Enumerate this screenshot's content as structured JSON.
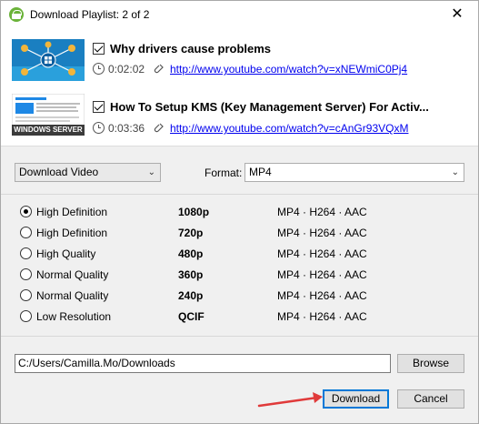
{
  "window": {
    "title": "Download Playlist: 2 of 2",
    "close_glyph": "✕"
  },
  "playlist": [
    {
      "title": "Why drivers cause problems",
      "duration": "0:02:02",
      "url": "http://www.youtube.com/watch?v=xNEWmiC0Pj4",
      "checked": true,
      "thumb_icon": "network-diagram-thumbnail"
    },
    {
      "title": "How To Setup KMS (Key Management Server) For Activ...",
      "duration": "0:03:36",
      "url": "http://www.youtube.com/watch?v=cAnGr93VQxM",
      "checked": true,
      "thumb_icon": "windows-server-thumbnail",
      "thumb_caption": "WINDOWS SERVER"
    }
  ],
  "options": {
    "download_type": "Download Video",
    "format_label": "Format:",
    "format_value": "MP4"
  },
  "qualities": [
    {
      "label": "High Definition",
      "resolution": "1080p",
      "codec": "MP4 · H264 · AAC",
      "selected": true
    },
    {
      "label": "High Definition",
      "resolution": "720p",
      "codec": "MP4 · H264 · AAC",
      "selected": false
    },
    {
      "label": "High Quality",
      "resolution": "480p",
      "codec": "MP4 · H264 · AAC",
      "selected": false
    },
    {
      "label": "Normal Quality",
      "resolution": "360p",
      "codec": "MP4 · H264 · AAC",
      "selected": false
    },
    {
      "label": "Normal Quality",
      "resolution": "240p",
      "codec": "MP4 · H264 · AAC",
      "selected": false
    },
    {
      "label": "Low Resolution",
      "resolution": "QCIF",
      "codec": "MP4 · H264 · AAC",
      "selected": false
    }
  ],
  "save": {
    "path": "C:/Users/Camilla.Mo/Downloads",
    "browse_label": "Browse"
  },
  "actions": {
    "download_label": "Download",
    "cancel_label": "Cancel"
  },
  "colors": {
    "accent": "#0078d7",
    "link": "#0000ee",
    "annotation_arrow": "#e03a3a",
    "app_icon": "#6bb33a"
  }
}
